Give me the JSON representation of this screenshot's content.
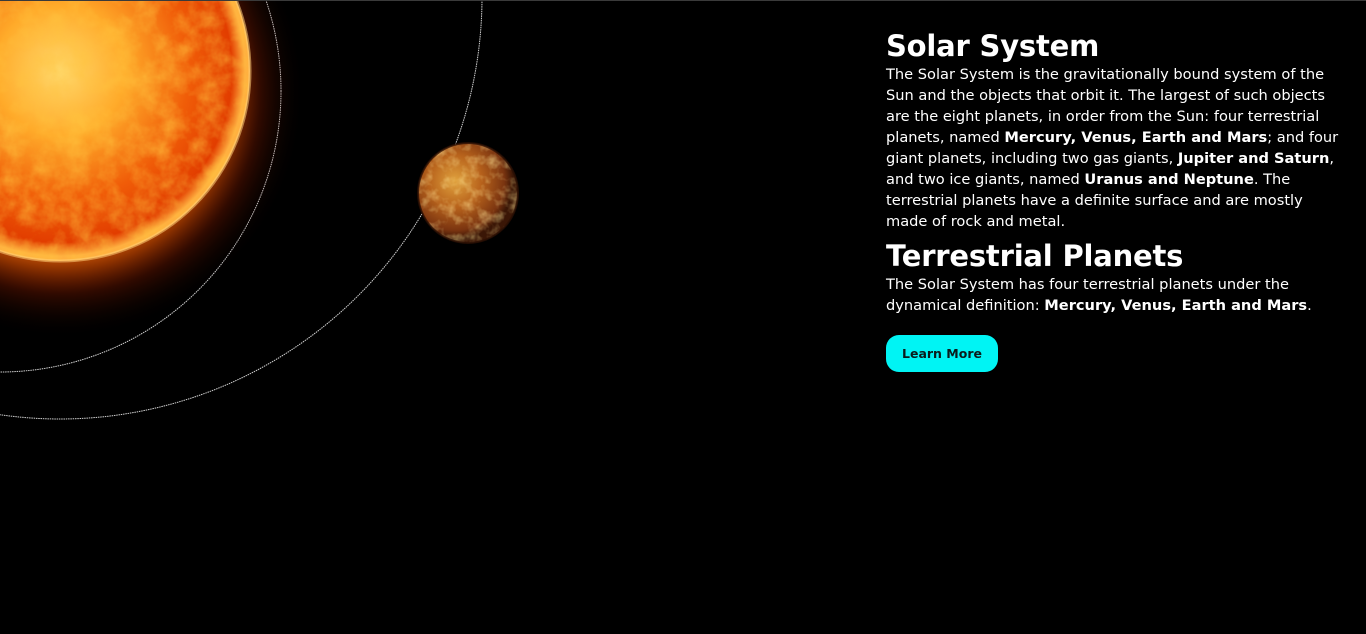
{
  "sections": {
    "solar_system": {
      "title": "Solar System",
      "body_1": "The Solar System is the gravitationally bound system of the Sun and the objects that orbit it. The largest of such objects are the eight planets, in order from the Sun: four terrestrial planets, named ",
      "bold_1": "Mercury, Venus, Earth and Mars",
      "body_2": "; and four giant planets, including two gas giants, ",
      "bold_2": "Jupiter and Saturn",
      "body_3": ", and two ice giants, named ",
      "bold_3": "Uranus and Neptune",
      "body_4": ". The terrestrial planets have a definite surface and are mostly made of rock and metal."
    },
    "terrestrial_planets": {
      "title": "Terrestrial Planets",
      "body_1": "The Solar System has four terrestrial planets under the dynamical definition: ",
      "bold_1": "Mercury, Venus, Earth and Mars",
      "body_2": "."
    }
  },
  "cta": {
    "label": "Learn More"
  },
  "scene": {
    "sun": "sun",
    "planet": "planet",
    "orbit_color": "#cfcfcf"
  },
  "theme": {
    "background": "#000000",
    "accent": "#00f4f4",
    "text": "#ffffff"
  }
}
